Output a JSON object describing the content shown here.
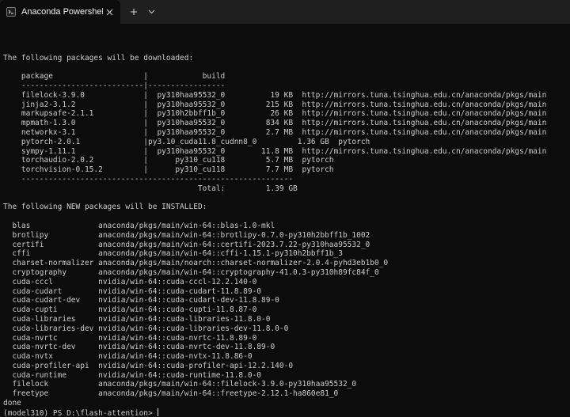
{
  "tab": {
    "title": "Anaconda Powershell Prompt",
    "icon": "terminal-icon"
  },
  "tabbar_buttons": {
    "new_tab": "+",
    "dropdown": "chevron-down-icon"
  },
  "terminal": {
    "lines": [
      "",
      "",
      "The following packages will be downloaded:",
      "",
      "    package                    |            build",
      "    ---------------------------|-----------------",
      "    filelock-3.9.0             |  py310haa95532_0          19 KB  http://mirrors.tuna.tsinghua.edu.cn/anaconda/pkgs/main",
      "    jinja2-3.1.2               |  py310haa95532_0         215 KB  http://mirrors.tuna.tsinghua.edu.cn/anaconda/pkgs/main",
      "    markupsafe-2.1.1           |  py310h2bbff1b_0          26 KB  http://mirrors.tuna.tsinghua.edu.cn/anaconda/pkgs/main",
      "    mpmath-1.3.0               |  py310haa95532_0         834 KB  http://mirrors.tuna.tsinghua.edu.cn/anaconda/pkgs/main",
      "    networkx-3.1               |  py310haa95532_0         2.7 MB  http://mirrors.tuna.tsinghua.edu.cn/anaconda/pkgs/main",
      "    pytorch-2.0.1              |py3.10_cuda11.8_cudnn8_0         1.36 GB  pytorch",
      "    sympy-1.11.1               |  py310haa95532_0        11.8 MB  http://mirrors.tuna.tsinghua.edu.cn/anaconda/pkgs/main",
      "    torchaudio-2.0.2           |      py310_cu118         5.7 MB  pytorch",
      "    torchvision-0.15.2         |      py310_cu118         7.7 MB  pytorch",
      "    ------------------------------------------------------------",
      "                                           Total:         1.39 GB",
      "",
      "The following NEW packages will be INSTALLED:",
      "",
      "  blas               anaconda/pkgs/main/win-64::blas-1.0-mkl",
      "  brotlipy           anaconda/pkgs/main/win-64::brotlipy-0.7.0-py310h2bbff1b_1002",
      "  certifi            anaconda/pkgs/main/win-64::certifi-2023.7.22-py310haa95532_0",
      "  cffi               anaconda/pkgs/main/win-64::cffi-1.15.1-py310h2bbff1b_3",
      "  charset-normalizer anaconda/pkgs/main/noarch::charset-normalizer-2.0.4-pyhd3eb1b0_0",
      "  cryptography       anaconda/pkgs/main/win-64::cryptography-41.0.3-py310h89fc84f_0",
      "  cuda-cccl          nvidia/win-64::cuda-cccl-12.2.140-0",
      "  cuda-cudart        nvidia/win-64::cuda-cudart-11.8.89-0",
      "  cuda-cudart-dev    nvidia/win-64::cuda-cudart-dev-11.8.89-0",
      "  cuda-cupti         nvidia/win-64::cuda-cupti-11.8.87-0",
      "  cuda-libraries     nvidia/win-64::cuda-libraries-11.8.0-0",
      "  cuda-libraries-dev nvidia/win-64::cuda-libraries-dev-11.8.0-0",
      "  cuda-nvrtc         nvidia/win-64::cuda-nvrtc-11.8.89-0",
      "  cuda-nvrtc-dev     nvidia/win-64::cuda-nvrtc-dev-11.8.89-0",
      "  cuda-nvtx          nvidia/win-64::cuda-nvtx-11.8.86-0",
      "  cuda-profiler-api  nvidia/win-64::cuda-profiler-api-12.2.140-0",
      "  cuda-runtime       nvidia/win-64::cuda-runtime-11.8.0-0",
      "  filelock           anaconda/pkgs/main/win-64::filelock-3.9.0-py310haa95532_0",
      "  freetype           anaconda/pkgs/main/win-64::freetype-2.12.1-ha860e81_0",
      "done"
    ],
    "prompt": "(model310) PS D:\\flash-attention> "
  },
  "colors": {
    "background": "#0c0c0c",
    "tabbar": "#1f1f1f",
    "text": "#cccccc"
  }
}
